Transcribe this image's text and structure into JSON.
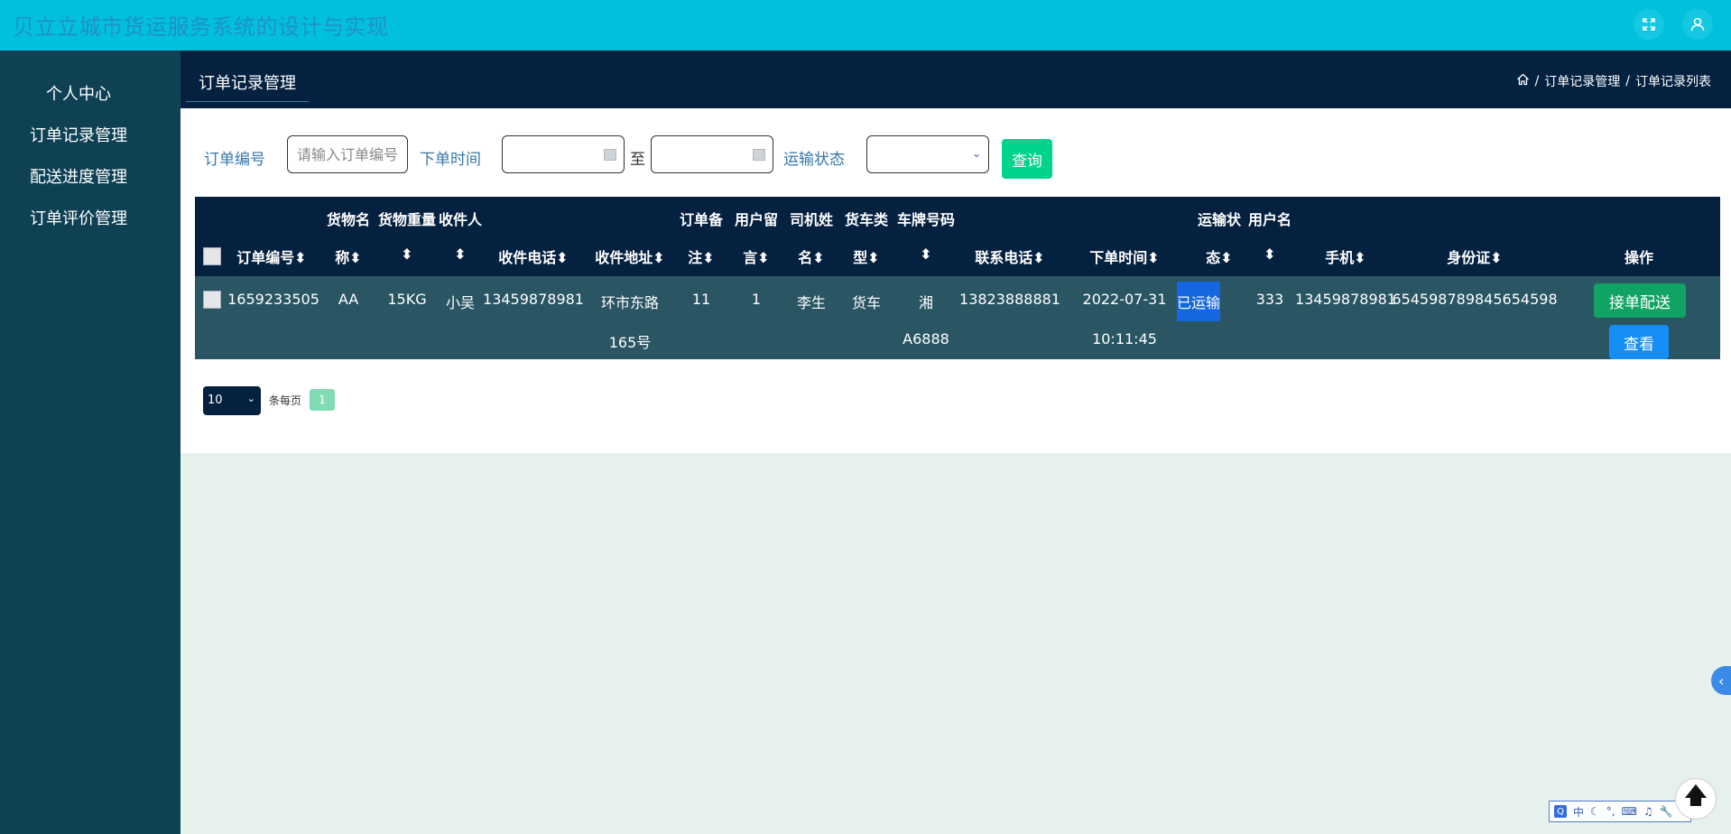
{
  "app": {
    "title": "贝立立城市货运服务系统的设计与实现"
  },
  "icons": {
    "fullscreen": "expand-icon",
    "user": "user-icon",
    "home": "home-icon",
    "calendar": "calendar-icon",
    "chevron": "chevron-down-icon"
  },
  "sidebar": {
    "items": [
      {
        "label": "个人中心"
      },
      {
        "label": "订单记录管理"
      },
      {
        "label": "配送进度管理"
      },
      {
        "label": "订单评价管理"
      }
    ]
  },
  "header": {
    "tab": "订单记录管理",
    "breadcrumb": {
      "sep": "/",
      "level1": "订单记录管理",
      "level2": "订单记录列表"
    }
  },
  "search": {
    "order_no_label": "订单编号",
    "order_no_placeholder": "请输入订单编号",
    "order_time_label": "下单时间",
    "to_label": "至",
    "status_label": "运输状态",
    "query_button": "查询"
  },
  "table": {
    "headers": {
      "order_no": "订单编号",
      "goods_name_1": "货物名",
      "goods_name_2": "称",
      "weight": "货物重量",
      "receiver": "收件人",
      "phone": "收件电话",
      "address": "收件地址",
      "remark_1": "订单备",
      "remark_2": "注",
      "message_1": "用户留",
      "message_2": "言",
      "driver_1": "司机姓",
      "driver_2": "名",
      "truck_type_1": "货车类",
      "truck_type_2": "型",
      "plate": "车牌号码",
      "contact": "联系电话",
      "order_time": "下单时间",
      "status_1": "运输状",
      "status_2": "态",
      "username": "用户名",
      "mobile": "手机",
      "id_card": "身份证",
      "action": "操作"
    },
    "rows": [
      {
        "order_no": "1659233505",
        "goods_name": "AA",
        "weight": "15KG",
        "receiver": "小吴",
        "phone": "13459878981",
        "address_1": "环市东路",
        "address_2": "165号",
        "remark": "11",
        "message": "1",
        "driver": "李生",
        "truck_type": "货车",
        "plate_1": "湘",
        "plate_2": "A6888",
        "contact": "13823888881",
        "order_date": "2022-07-31",
        "order_clock": "10:11:45",
        "status": "已运输",
        "username": "333",
        "mobile": "13459878981",
        "id_card": "654598789845654598",
        "accept_button": "接单配送",
        "view_button": "查看"
      }
    ]
  },
  "pagination": {
    "page_size": "10",
    "per_page_label": "条每页",
    "current_page": "1"
  },
  "ime": {
    "q": "Q",
    "lang": "中",
    "moon": "☾",
    "punct": "°,",
    "kbd": "⌨",
    "fw": "♫",
    "tool": "🔧"
  }
}
